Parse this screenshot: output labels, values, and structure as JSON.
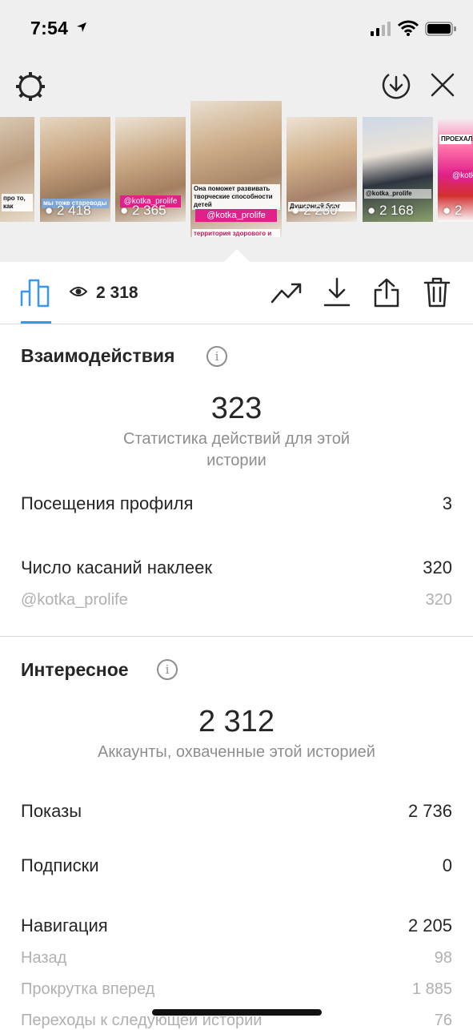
{
  "status_bar": {
    "time": "7:54"
  },
  "stories": [
    {
      "caption": "про то, как",
      "views": ""
    },
    {
      "caption": "мы тоже стареводы",
      "views": "2 418"
    },
    {
      "tag": "@kotka_prolife",
      "views": "2 365"
    },
    {
      "caption": "Она поможет развивать творческие способности детей",
      "tag": "@kotka_prolife",
      "caption2": "территория здорового и",
      "views": ""
    },
    {
      "caption": "Душевный блог",
      "views": "2 230"
    },
    {
      "tag": "@kotka_prolife",
      "views": "2 168"
    },
    {
      "caption": "ПРОЕХАЛА",
      "tag": "@kotka",
      "views": "2"
    }
  ],
  "toolbar": {
    "view_count": "2 318"
  },
  "interactions": {
    "title": "Взаимодействия",
    "total": "323",
    "caption": "Статистика действий для этой истории",
    "rows": [
      {
        "label": "Посещения профиля",
        "value": "3"
      },
      {
        "label": "Число касаний наклеек",
        "value": "320"
      }
    ],
    "sub_rows": [
      {
        "label": "@kotka_prolife",
        "value": "320"
      }
    ]
  },
  "discovery": {
    "title": "Интересное",
    "total": "2 312",
    "caption": "Аккаунты, охваченные этой историей",
    "rows": [
      {
        "label": "Показы",
        "value": "2 736"
      },
      {
        "label": "Подписки",
        "value": "0"
      },
      {
        "label": "Навигация",
        "value": "2 205"
      }
    ],
    "sub_rows": [
      {
        "label": "Назад",
        "value": "98"
      },
      {
        "label": "Прокрутка вперед",
        "value": "1 885"
      },
      {
        "label": "Переходы к следующей истории",
        "value": "76"
      }
    ]
  },
  "colors": {
    "accent": "#3897f0",
    "tag": "#e0218a"
  }
}
